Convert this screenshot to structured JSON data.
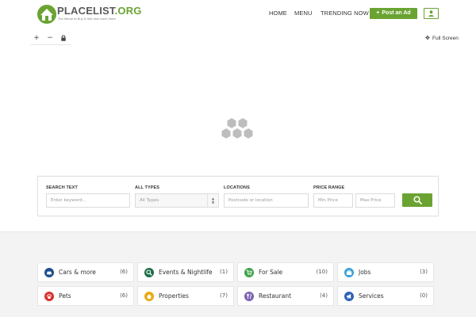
{
  "header": {
    "logo": {
      "text_a": "PLACELIST",
      "text_b": ".ORG",
      "tagline": "The Venue to Buy & Sell and much more"
    },
    "nav": {
      "home": "HOME",
      "menu": "MENU",
      "trending": "TRENDING NOW"
    },
    "post_ad_label": "Post an Ad"
  },
  "map": {
    "zoom_in": "+",
    "zoom_out": "−",
    "fullscreen_label": "Full Screen"
  },
  "search": {
    "text_label": "SEARCH TEXT",
    "text_placeholder": "Enter keyword...",
    "types_label": "ALL TYPES",
    "types_value": "All Types",
    "locations_label": "LOCATIONS",
    "locations_placeholder": "Postcode or location",
    "price_label": "PRICE RANGE",
    "min_placeholder": "Min Price",
    "max_placeholder": "Max Price"
  },
  "categories": [
    {
      "name": "Cars & more",
      "count": "(6)",
      "icon": "car-icon",
      "color": "#1f4f8f"
    },
    {
      "name": "Events & Nightlife",
      "count": "(1)",
      "icon": "search-location-icon",
      "color": "#1f6e49"
    },
    {
      "name": "For Sale",
      "count": "(10)",
      "icon": "cart-icon",
      "color": "#3fa24a"
    },
    {
      "name": "Jobs",
      "count": "(3)",
      "icon": "briefcase-icon",
      "color": "#3aa0d8"
    },
    {
      "name": "Pets",
      "count": "(6)",
      "icon": "paw-icon",
      "color": "#d9302f"
    },
    {
      "name": "Properties",
      "count": "(7)",
      "icon": "home-icon",
      "color": "#e7a915"
    },
    {
      "name": "Restaurant",
      "count": "(4)",
      "icon": "cutlery-icon",
      "color": "#7b62b3"
    },
    {
      "name": "Services",
      "count": "(0)",
      "icon": "megaphone-icon",
      "color": "#2f63b8"
    }
  ],
  "colors": {
    "brand": "#6aa332",
    "loader": "#bdbdbd"
  }
}
